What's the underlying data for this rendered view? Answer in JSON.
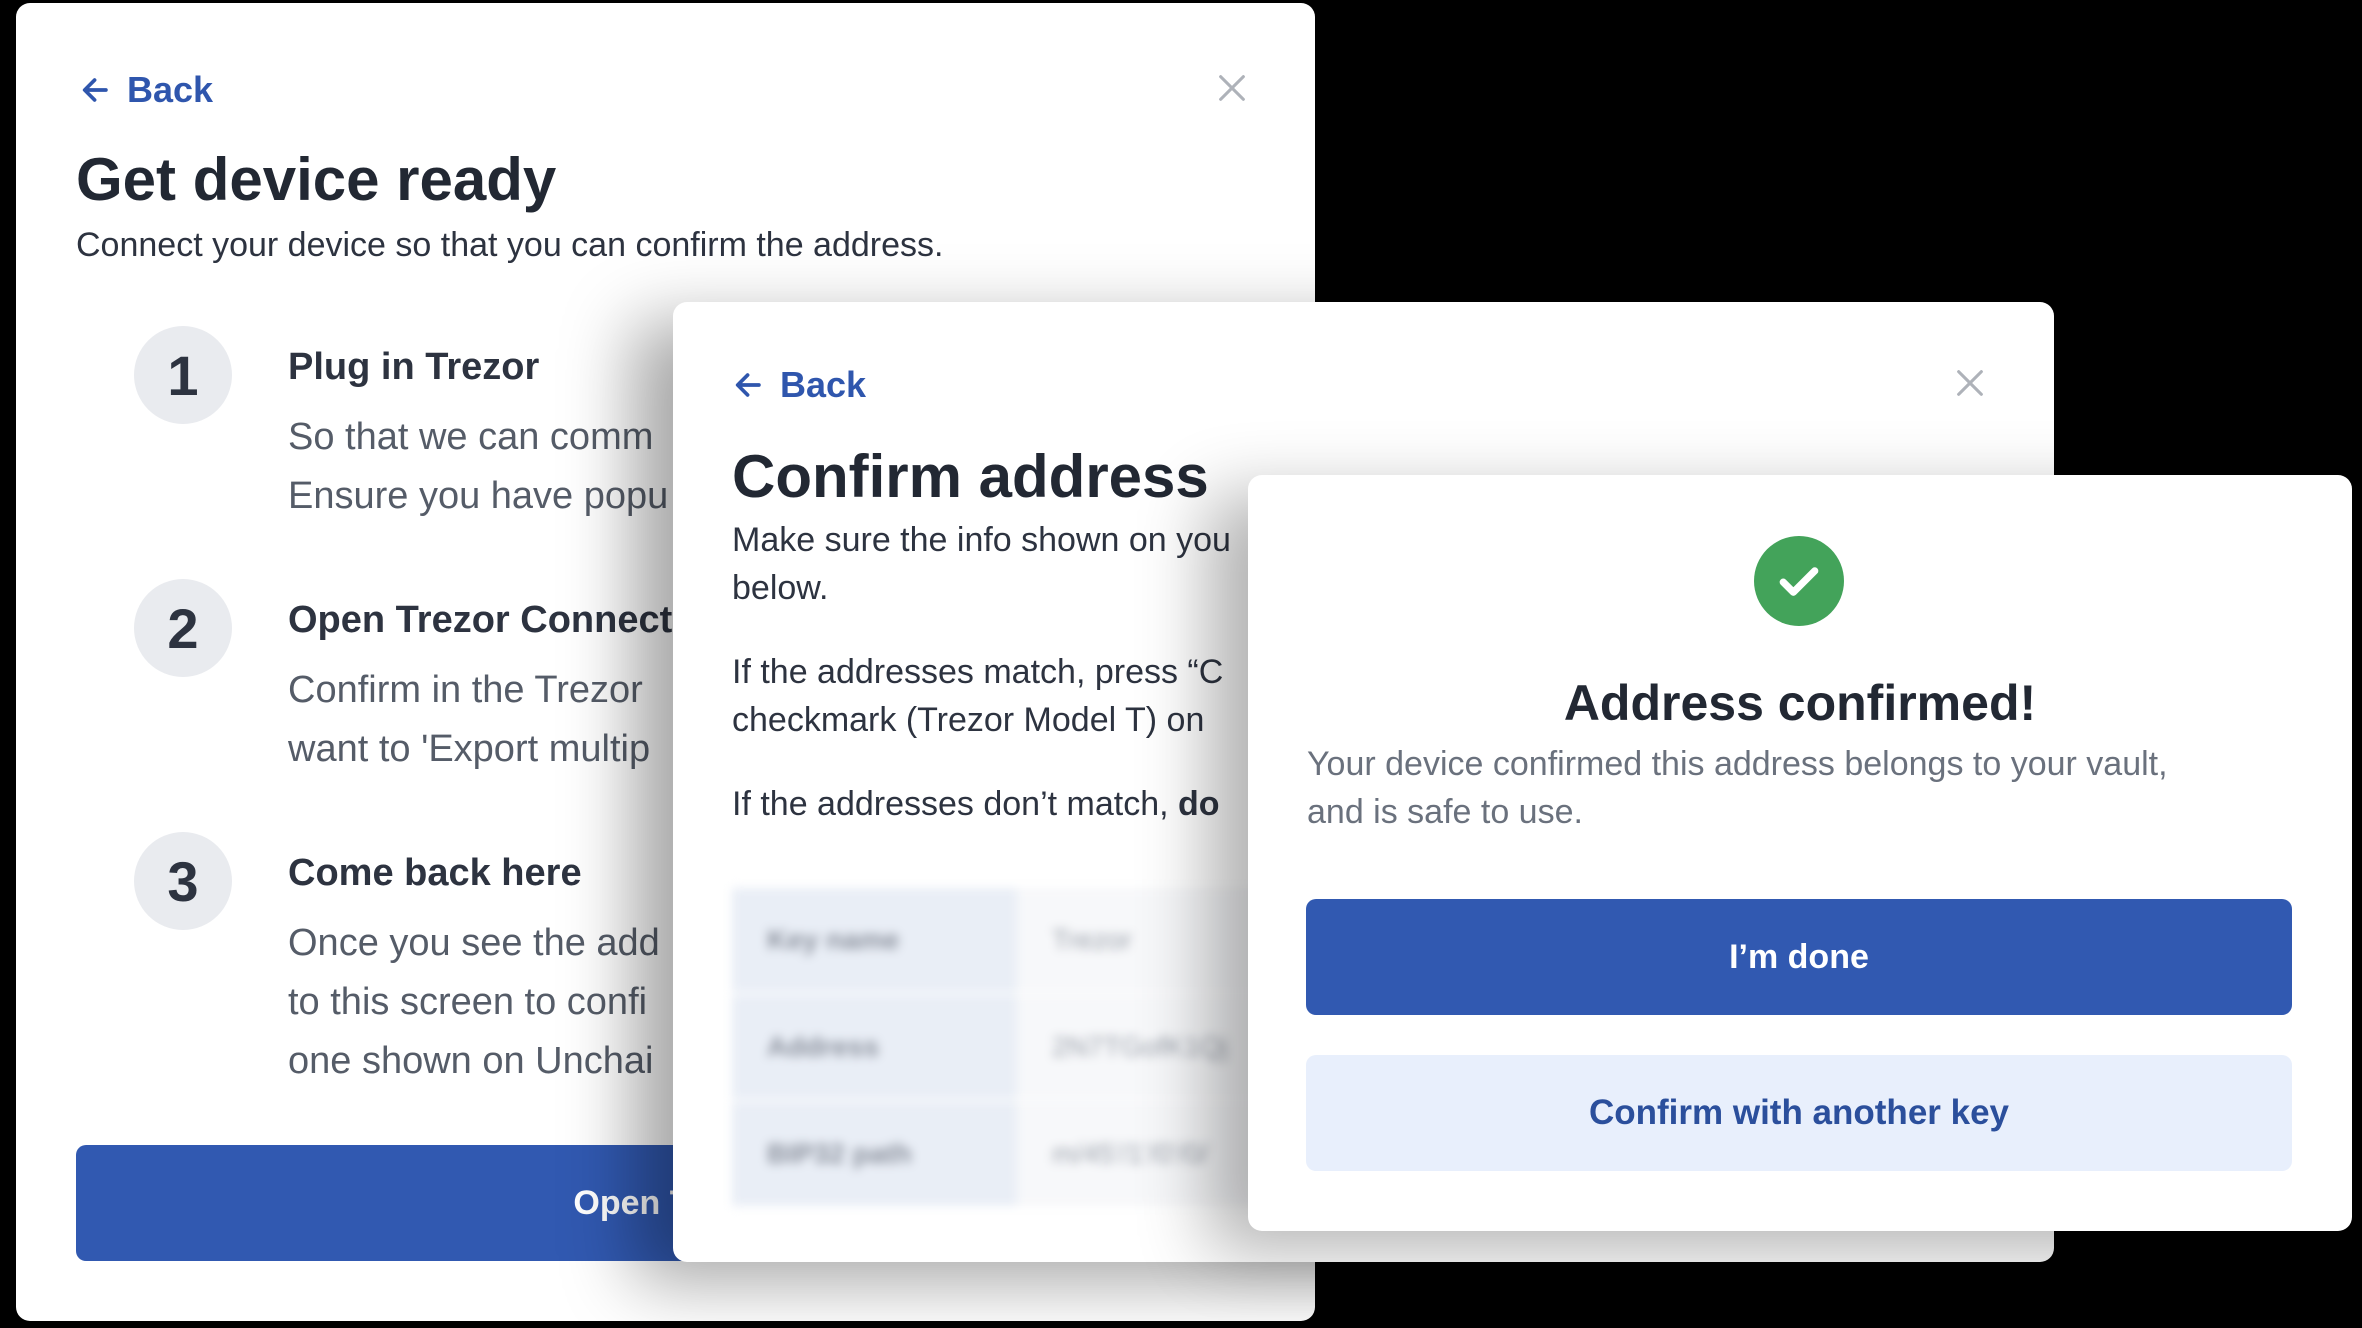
{
  "panel1": {
    "back_label": "Back",
    "title": "Get device ready",
    "subtitle": "Connect your device so that you can confirm the address.",
    "steps": [
      {
        "number": "1",
        "title": "Plug in Trezor",
        "lines": [
          "So that we can comm",
          "Ensure you have popu"
        ]
      },
      {
        "number": "2",
        "title": "Open Trezor Connect",
        "lines": [
          "Confirm in the Trezor",
          "want to 'Export multip"
        ]
      },
      {
        "number": "3",
        "title": "Come back here",
        "lines": [
          "Once you see the add",
          "to this screen to confi",
          "one shown on Unchai"
        ]
      }
    ],
    "button_label": "Open Trezo"
  },
  "panel2": {
    "back_label": "Back",
    "title": "Confirm address",
    "intro_line1": "Make sure the info shown on you",
    "intro_line2": "below.",
    "match_line1": "If the addresses match, press “C",
    "match_line2": "checkmark (Trezor Model T) on",
    "mismatch_text": "If the addresses don’t match, ",
    "mismatch_bold": "do",
    "table": [
      {
        "key": "Key name",
        "value": "Trezor"
      },
      {
        "key": "Address",
        "value": "2N7TGofK1Qj"
      },
      {
        "key": "BIP32 path",
        "value": "m/45'/1'/0'/0/"
      }
    ]
  },
  "panel3": {
    "title": "Address confirmed!",
    "desc_line1": "Your device confirmed this address belongs to your vault,",
    "desc_line2": "and is safe to use.",
    "primary_button": "I’m done",
    "secondary_button": "Confirm with another key"
  },
  "colors": {
    "accent": "#3159b1",
    "success": "#43a35a",
    "secondary_bg": "#e8effc"
  },
  "icons": [
    "arrow-left-icon",
    "close-icon",
    "checkmark-icon"
  ]
}
